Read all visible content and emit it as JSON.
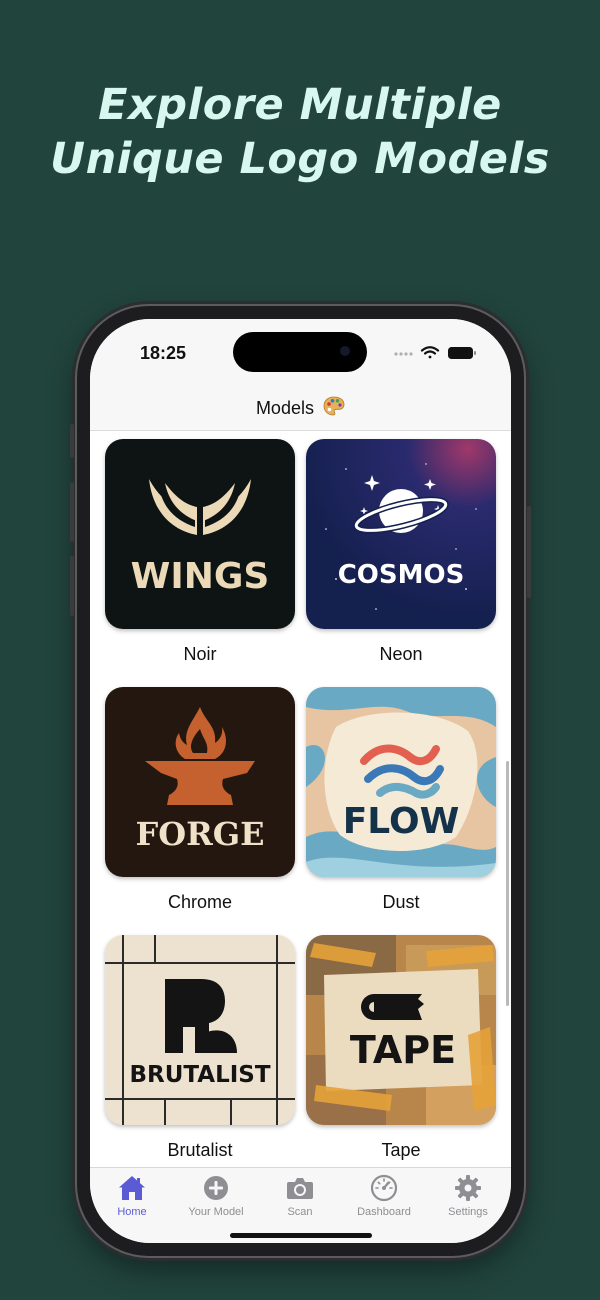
{
  "headline": {
    "line1": "Explore Multiple",
    "line2": "Unique Logo Models"
  },
  "status_bar": {
    "time": "18:25"
  },
  "nav": {
    "title": "Models",
    "title_icon": "palette-icon"
  },
  "models": [
    {
      "name": "Noir",
      "logo_text": "WINGS"
    },
    {
      "name": "Neon",
      "logo_text": "COSMOS"
    },
    {
      "name": "Chrome",
      "logo_text": "FORGE"
    },
    {
      "name": "Dust",
      "logo_text": "FLOW"
    },
    {
      "name": "Brutalist",
      "logo_text": "BRUTALIST"
    },
    {
      "name": "Tape",
      "logo_text": "TAPE"
    }
  ],
  "tabs": [
    {
      "label": "Home",
      "icon": "house-icon",
      "active": true
    },
    {
      "label": "Your Model",
      "icon": "plus-circle-icon",
      "active": false
    },
    {
      "label": "Scan",
      "icon": "camera-icon",
      "active": false
    },
    {
      "label": "Dashboard",
      "icon": "gauge-icon",
      "active": false
    },
    {
      "label": "Settings",
      "icon": "gear-icon",
      "active": false
    }
  ],
  "colors": {
    "background": "#21443d",
    "headline": "#d8f7ef",
    "accent": "#5b5bd6"
  }
}
